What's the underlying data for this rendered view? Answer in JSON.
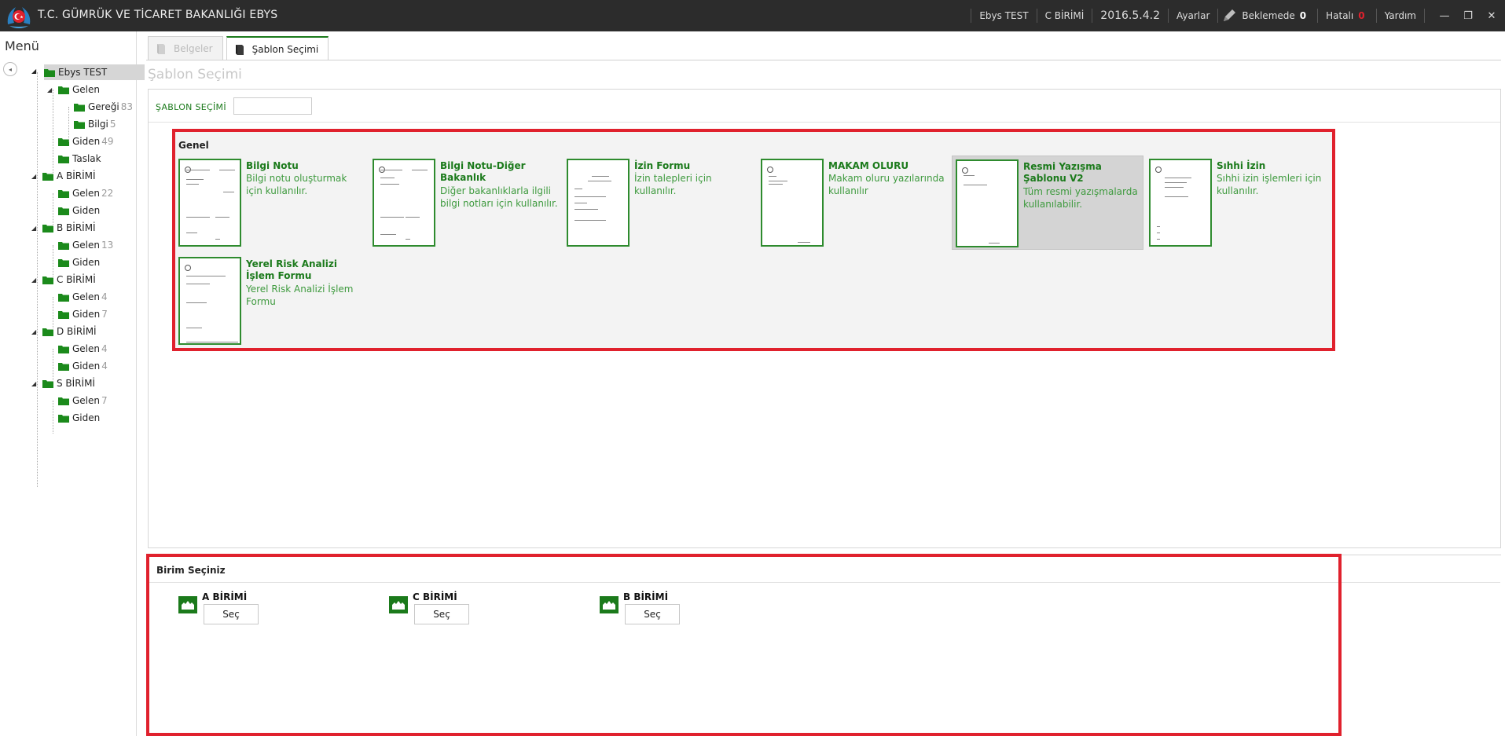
{
  "app": {
    "title": "T.C. GÜMRÜK VE TİCARET BAKANLIĞI EBYS"
  },
  "topbar": {
    "user": "Ebys TEST",
    "unit": "C BİRİMİ",
    "version": "2016.5.4.2",
    "settings": "Ayarlar",
    "pending_label": "Beklemede",
    "pending_count": "0",
    "error_label": "Hatalı",
    "error_count": "0",
    "help": "Yardım",
    "minimize_glyph": "—",
    "restore_glyph": "❐",
    "close_glyph": "✕"
  },
  "sidebar": {
    "title": "Menü",
    "collapse_glyph": "◂",
    "tree": [
      {
        "label": "Ebys TEST",
        "count": "",
        "level": 0,
        "toggle": "◢",
        "selected": true
      },
      {
        "label": "Gelen",
        "count": "",
        "level": 1,
        "toggle": "◢"
      },
      {
        "label": "Gereği",
        "count": "83",
        "level": 2,
        "toggle": ""
      },
      {
        "label": "Bilgi",
        "count": "5",
        "level": 2,
        "toggle": ""
      },
      {
        "label": "Giden",
        "count": "49",
        "level": 1,
        "toggle": ""
      },
      {
        "label": "Taslak",
        "count": "",
        "level": 1,
        "toggle": ""
      },
      {
        "label": "A BİRİMİ",
        "count": "",
        "level": 0,
        "toggle": "◢"
      },
      {
        "label": "Gelen",
        "count": "22",
        "level": 1,
        "toggle": ""
      },
      {
        "label": "Giden",
        "count": "",
        "level": 1,
        "toggle": ""
      },
      {
        "label": "B BİRİMİ",
        "count": "",
        "level": 0,
        "toggle": "◢"
      },
      {
        "label": "Gelen",
        "count": "13",
        "level": 1,
        "toggle": ""
      },
      {
        "label": "Giden",
        "count": "",
        "level": 1,
        "toggle": ""
      },
      {
        "label": "C BİRİMİ",
        "count": "",
        "level": 0,
        "toggle": "◢"
      },
      {
        "label": "Gelen",
        "count": "4",
        "level": 1,
        "toggle": ""
      },
      {
        "label": "Giden",
        "count": "7",
        "level": 1,
        "toggle": ""
      },
      {
        "label": "D BİRİMİ",
        "count": "",
        "level": 0,
        "toggle": "◢"
      },
      {
        "label": "Gelen",
        "count": "4",
        "level": 1,
        "toggle": ""
      },
      {
        "label": "Giden",
        "count": "4",
        "level": 1,
        "toggle": ""
      },
      {
        "label": "S BİRİMİ",
        "count": "",
        "level": 0,
        "toggle": "◢"
      },
      {
        "label": "Gelen",
        "count": "7",
        "level": 1,
        "toggle": ""
      },
      {
        "label": "Giden",
        "count": "",
        "level": 1,
        "toggle": ""
      }
    ]
  },
  "tabs": [
    {
      "label": "Belgeler",
      "state": "disabled"
    },
    {
      "label": "Şablon Seçimi",
      "state": "active"
    }
  ],
  "main": {
    "page_title": "Şablon Seçimi",
    "sablon_label": "ŞABLON SEÇİMİ",
    "sablon_input_value": "",
    "group_title": "Genel",
    "templates": [
      {
        "name": "Bilgi Notu",
        "desc": "Bilgi notu oluşturmak için kullanılır.",
        "highlight": false
      },
      {
        "name": "Bilgi Notu-Diğer Bakanlık",
        "desc": "Diğer bakanlıklarla ilgili bilgi notları için kullanılır.",
        "highlight": false
      },
      {
        "name": "İzin Formu",
        "desc": "İzin talepleri için kullanılır.",
        "highlight": false
      },
      {
        "name": "MAKAM OLURU",
        "desc": "Makam oluru yazılarında kullanılır",
        "highlight": false
      },
      {
        "name": "Resmi Yazışma Şablonu V2",
        "desc": "Tüm resmi yazışmalarda kullanılabilir.",
        "highlight": true
      },
      {
        "name": "Sıhhi İzin",
        "desc": "Sıhhi izin işlemleri için kullanılır.",
        "highlight": false
      },
      {
        "name": "Yerel Risk Analizi İşlem Formu",
        "desc": "Yerel Risk Analizi İşlem Formu",
        "highlight": false
      }
    ]
  },
  "birim": {
    "title": "Birim Seçiniz",
    "units": [
      {
        "name": "A BİRİMİ",
        "button": "Seç"
      },
      {
        "name": "C BİRİMİ",
        "button": "Seç"
      },
      {
        "name": "B BİRİMİ",
        "button": "Seç"
      }
    ]
  },
  "colors": {
    "brand_green": "#1b7a1b",
    "highlight_red": "#e0212d",
    "titlebar": "#2c2c2c",
    "error_count": "#e0212d"
  }
}
